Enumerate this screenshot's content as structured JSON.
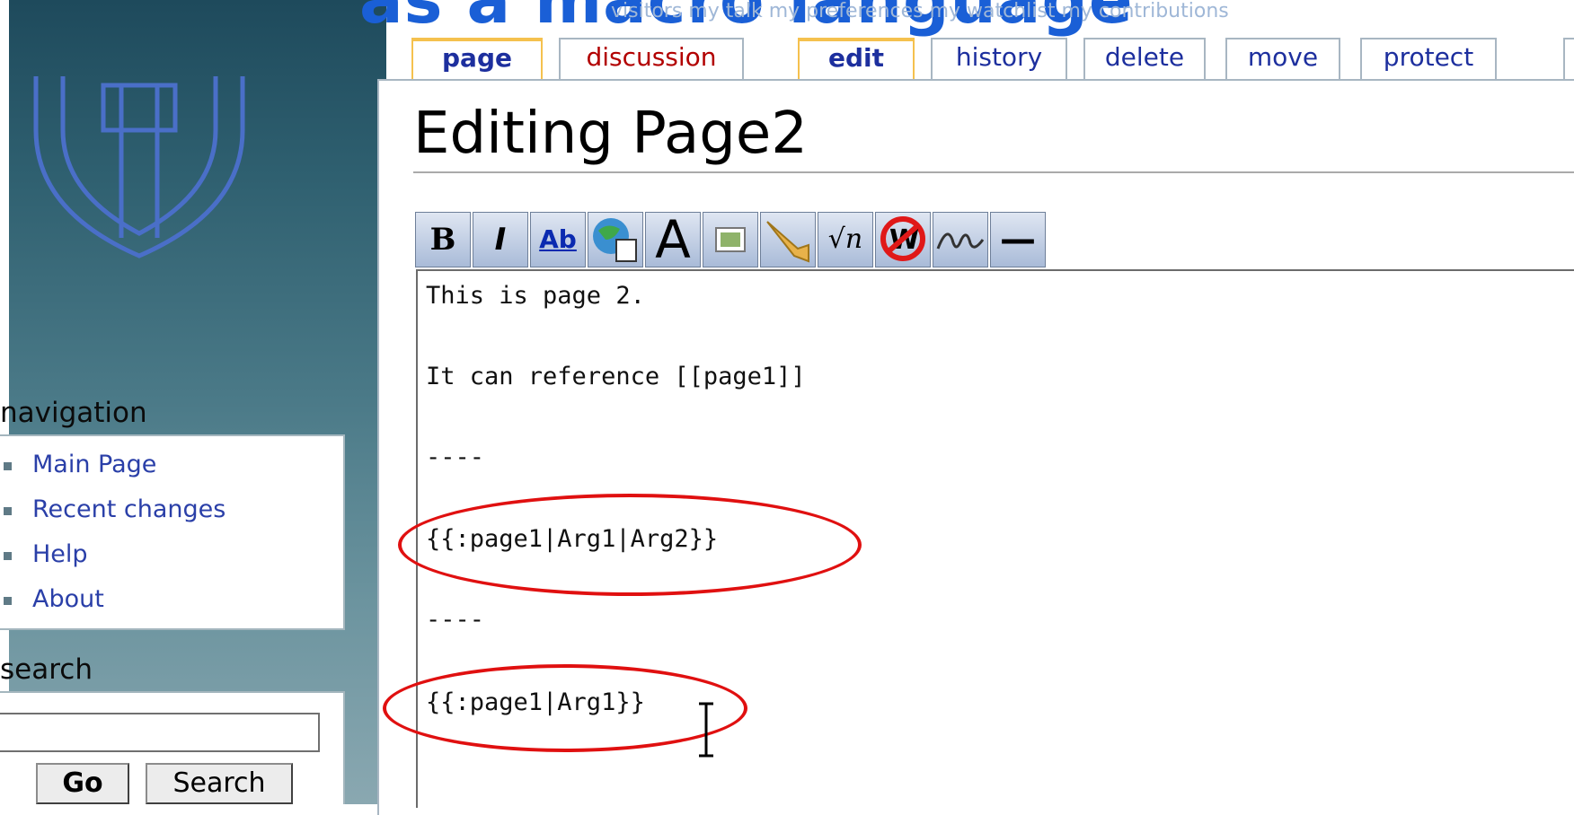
{
  "slide_title": "as a macro language",
  "user_links": "visitors   my talk   my preferences   my watchlist   my contributions",
  "tabs": {
    "page": "page",
    "discussion": "discussion",
    "edit": "edit",
    "history": "history",
    "delete": "delete",
    "move": "move",
    "protect": "protect"
  },
  "heading": "Editing Page2",
  "toolbar": {
    "bold": "B",
    "italic": "I",
    "link": "Ab",
    "headline": "A",
    "math": "√n",
    "hr": "—"
  },
  "navigation": {
    "title": "navigation",
    "items": [
      {
        "label": "Main Page"
      },
      {
        "label": "Recent changes"
      },
      {
        "label": "Help"
      },
      {
        "label": "About"
      }
    ]
  },
  "search": {
    "title": "search",
    "value": "",
    "go": "Go",
    "search": "Search"
  },
  "editor": {
    "lines": [
      "This is page 2.",
      "It can reference [[page1]]",
      "----",
      "{{:page1|Arg1|Arg2}}",
      "----",
      "{{:page1|Arg1}}"
    ]
  },
  "colors": {
    "link": "#2a3fa8",
    "annotation": "#e01010",
    "tab_selected_border": "#f5c14e"
  }
}
